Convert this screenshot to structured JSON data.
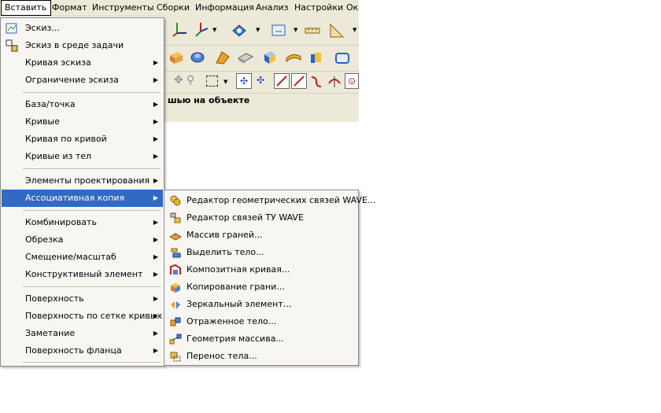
{
  "menubar": {
    "items": [
      "Вставить",
      "Формат",
      "Инструменты",
      "Сборки",
      "Информация",
      "Анализ",
      "Настройки",
      "Ок"
    ]
  },
  "hint": "шью на объекте",
  "menu": {
    "items": [
      {
        "label": "Эскиз...",
        "icon": "sketch-icon",
        "submenu": false
      },
      {
        "label": "Эскиз в среде задачи",
        "icon": "task-sketch-icon",
        "submenu": false
      },
      {
        "label": "Кривая эскиза",
        "submenu": true
      },
      {
        "label": "Ограничение эскиза",
        "submenu": true
      },
      {
        "label": "База/точка",
        "submenu": true
      },
      {
        "label": "Кривые",
        "submenu": true
      },
      {
        "label": "Кривая по кривой",
        "submenu": true
      },
      {
        "label": "Кривые из тел",
        "submenu": true
      },
      {
        "label": "Элементы проектирования",
        "submenu": true
      },
      {
        "label": "Ассоциативная копия",
        "submenu": true,
        "highlighted": true
      },
      {
        "label": "Комбинировать",
        "submenu": true
      },
      {
        "label": "Обрезка",
        "submenu": true
      },
      {
        "label": "Смещение/масштаб",
        "submenu": true
      },
      {
        "label": "Конструктивный элемент",
        "submenu": true
      },
      {
        "label": "Поверхность",
        "submenu": true
      },
      {
        "label": "Поверхность по сетке кривых",
        "submenu": true
      },
      {
        "label": "Заметание",
        "submenu": true
      },
      {
        "label": "Поверхность фланца",
        "submenu": true
      }
    ]
  },
  "submenu": {
    "items": [
      {
        "label": "Редактор геометрических связей WAVE...",
        "icon": "wave-geometry-icon"
      },
      {
        "label": "Редактор связей ТУ WAVE",
        "icon": "wave-link-icon"
      },
      {
        "label": "Массив граней...",
        "icon": "face-array-icon"
      },
      {
        "label": "Выделить тело...",
        "icon": "extract-body-icon"
      },
      {
        "label": "Композитная кривая...",
        "icon": "composite-curve-icon"
      },
      {
        "label": "Копирование грани...",
        "icon": "copy-face-icon"
      },
      {
        "label": "Зеркальный элемент...",
        "icon": "mirror-feature-icon"
      },
      {
        "label": "Отраженное тело...",
        "icon": "mirror-body-icon"
      },
      {
        "label": "Геометрия массива...",
        "icon": "pattern-geometry-icon"
      },
      {
        "label": "Перенос тела...",
        "icon": "move-body-icon"
      }
    ]
  },
  "colors": {
    "highlight": "#316ac5",
    "menu_bg": "#f7f6f3",
    "bar_bg": "#ece9d8"
  }
}
